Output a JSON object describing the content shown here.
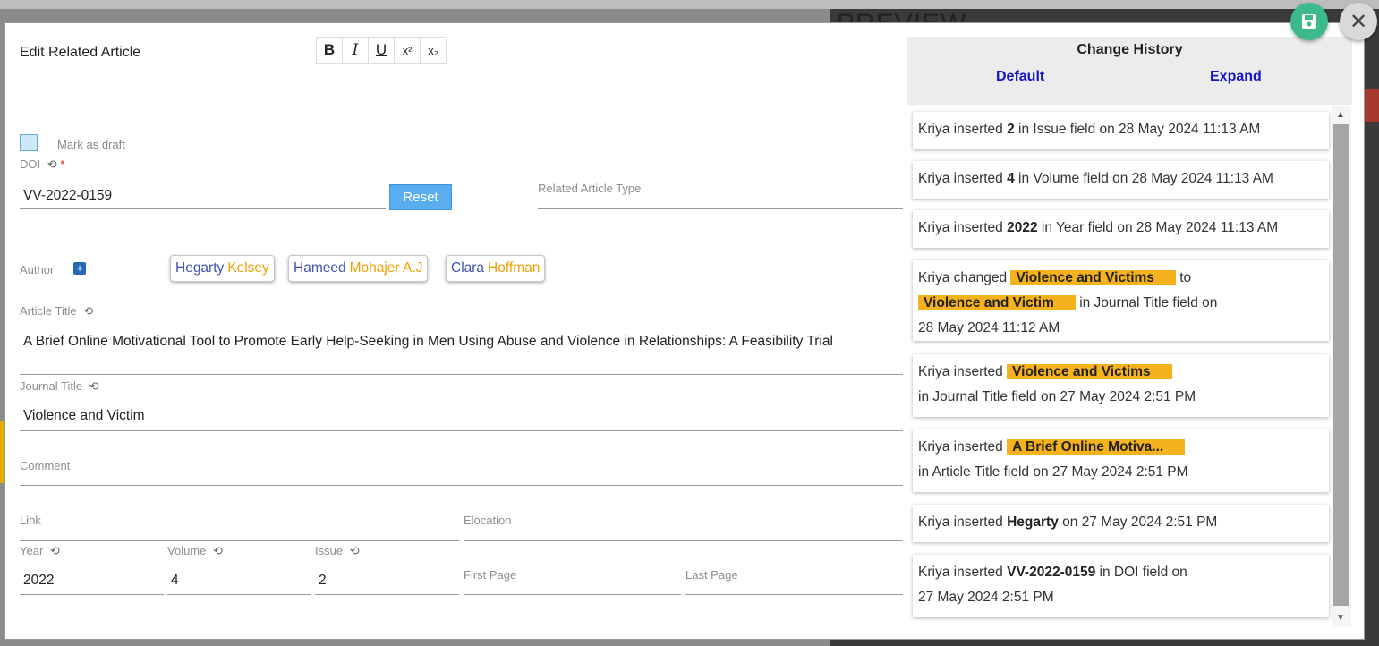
{
  "background": {
    "preview_title": "PREVIEW"
  },
  "modal": {
    "title": "Edit Related Article",
    "toolbar": {
      "bold": "B",
      "italic": "I",
      "underline": "U",
      "superscript": "x²",
      "subscript": "x₂"
    },
    "mark_as_draft": "Mark as draft",
    "doi": {
      "label": "DOI",
      "required_mark": "*",
      "value": "VV-2022-0159",
      "reset_label": "Reset"
    },
    "related_article_type": {
      "label": "Related Article Type",
      "value": ""
    },
    "author": {
      "label": "Author",
      "add_symbol": "+",
      "chips": [
        {
          "first": "Hegarty",
          "last": "Kelsey"
        },
        {
          "first": "Hameed",
          "last": "Mohajer A.J"
        },
        {
          "first": "Clara",
          "last": "Hoffman"
        }
      ]
    },
    "article_title": {
      "label": "Article Title",
      "value": "A Brief Online Motivational Tool to Promote Early Help-Seeking in Men Using Abuse and Violence in Relationships: A Feasibility Trial"
    },
    "journal_title": {
      "label": "Journal Title",
      "value": "Violence and Victim"
    },
    "comment": {
      "label": "Comment",
      "value": ""
    },
    "link": {
      "label": "Link",
      "value": ""
    },
    "elocation": {
      "label": "Elocation",
      "value": ""
    },
    "year": {
      "label": "Year",
      "value": "2022"
    },
    "volume": {
      "label": "Volume",
      "value": "4"
    },
    "issue": {
      "label": "Issue",
      "value": "2"
    },
    "first_page": {
      "label": "First Page",
      "value": ""
    },
    "last_page": {
      "label": "Last Page",
      "value": ""
    }
  },
  "change_history": {
    "title": "Change History",
    "default_label": "Default",
    "expand_label": "Expand",
    "entries": [
      {
        "user": "Kriya",
        "action": "inserted",
        "value": "2",
        "field_text": "in Issue field on 28 May 2024 11:13 AM"
      },
      {
        "user": "Kriya",
        "action": "inserted",
        "value": "4",
        "field_text": "in Volume field on 28 May 2024 11:13 AM"
      },
      {
        "user": "Kriya",
        "action": "inserted",
        "value": "2022",
        "field_text": "in Year field on 28 May 2024 11:13 AM"
      },
      {
        "user": "Kriya",
        "action": "changed",
        "old_value": "Violence and Victims",
        "to_word": "to",
        "new_value": "Violence and Victim",
        "field_text": "in Journal Title field on",
        "date": "28 May 2024 11:12 AM"
      },
      {
        "user": "Kriya",
        "action": "inserted",
        "value": "Violence and Victims",
        "field_text": "in Journal Title field on 27 May 2024 2:51 PM"
      },
      {
        "user": "Kriya",
        "action": "inserted",
        "value": "A Brief Online Motiva...",
        "field_text": "in Article Title field on 27 May 2024 2:51 PM"
      },
      {
        "user": "Kriya",
        "action": "inserted",
        "value": "Hegarty",
        "field_text": "on 27 May 2024 2:51 PM"
      },
      {
        "user": "Kriya",
        "action": "inserted",
        "value": "VV-2022-0159",
        "field_text": "in DOI field on",
        "date": "27 May 2024 2:51 PM"
      }
    ]
  }
}
